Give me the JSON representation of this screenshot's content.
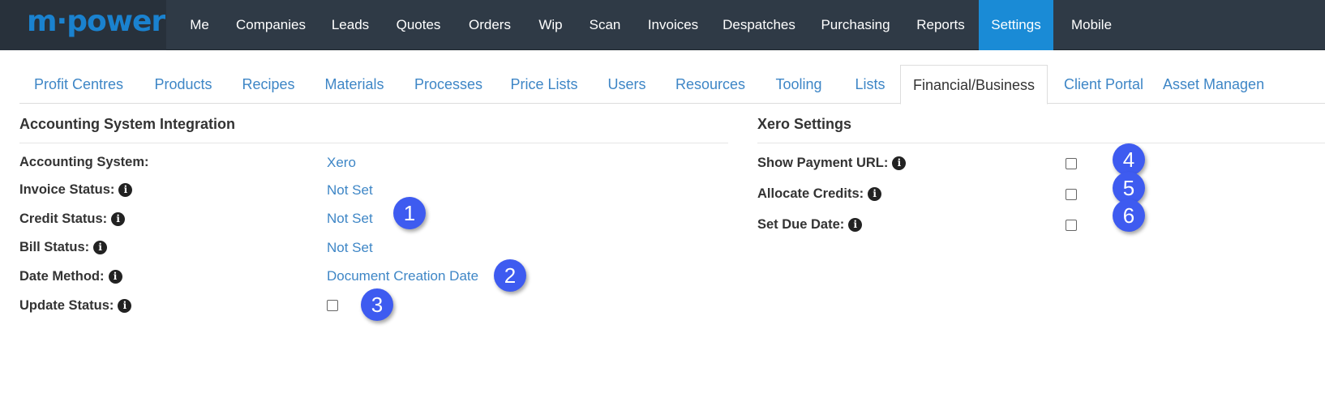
{
  "logo": {
    "text": "m·power"
  },
  "topnav": {
    "items": [
      {
        "label": "Me"
      },
      {
        "label": "Companies"
      },
      {
        "label": "Leads"
      },
      {
        "label": "Quotes"
      },
      {
        "label": "Orders"
      },
      {
        "label": "Wip"
      },
      {
        "label": "Scan"
      },
      {
        "label": "Invoices"
      },
      {
        "label": "Despatches"
      },
      {
        "label": "Purchasing"
      },
      {
        "label": "Reports"
      },
      {
        "label": "Settings"
      },
      {
        "label": "Mobile"
      }
    ],
    "active": "Settings"
  },
  "subtabs": {
    "items": [
      {
        "label": "Profit Centres"
      },
      {
        "label": "Products"
      },
      {
        "label": "Recipes"
      },
      {
        "label": "Materials"
      },
      {
        "label": "Processes"
      },
      {
        "label": "Price Lists"
      },
      {
        "label": "Users"
      },
      {
        "label": "Resources"
      },
      {
        "label": "Tooling"
      },
      {
        "label": "Lists"
      },
      {
        "label": "Financial/Business"
      },
      {
        "label": "Client Portal"
      },
      {
        "label": "Asset Managen"
      }
    ],
    "active": "Financial/Business"
  },
  "accounting": {
    "title": "Accounting System Integration",
    "rows": [
      {
        "label": "Accounting System:",
        "value": "Xero"
      },
      {
        "label": "Invoice Status:",
        "value": "Not Set"
      },
      {
        "label": "Credit Status:",
        "value": "Not Set"
      },
      {
        "label": "Bill Status:",
        "value": "Not Set"
      },
      {
        "label": "Date Method:",
        "value": "Document Creation Date"
      },
      {
        "label": "Update Status:",
        "checked": false
      }
    ]
  },
  "xero": {
    "title": "Xero Settings",
    "rows": [
      {
        "label": "Show Payment URL:",
        "checked": false
      },
      {
        "label": "Allocate Credits:",
        "checked": false
      },
      {
        "label": "Set Due Date:",
        "checked": false
      }
    ]
  },
  "info_icon": "info-circle-icon",
  "callouts": [
    "1",
    "2",
    "3",
    "4",
    "5",
    "6"
  ],
  "colors": {
    "topbar": "#2f3a46",
    "active_nav": "#1a8bd6",
    "link": "#3e86c6",
    "callout": "#3e5bf0"
  }
}
